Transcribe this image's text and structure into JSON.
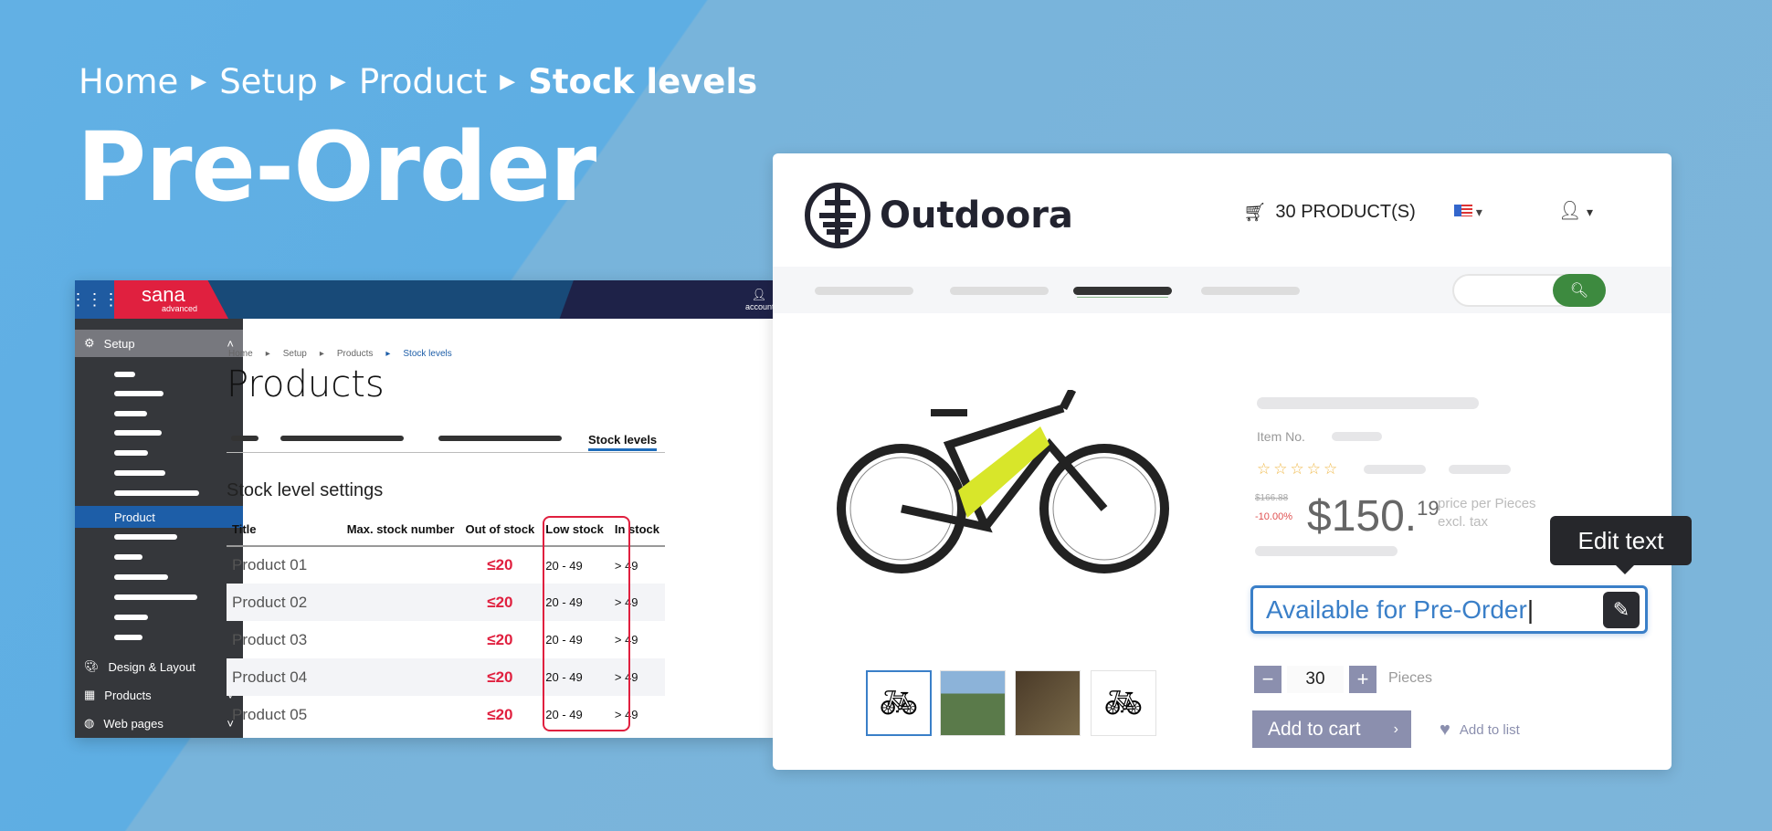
{
  "hero": {
    "breadcrumb": [
      "Home",
      "Setup",
      "Product",
      "Stock levels"
    ],
    "title": "Pre-Order"
  },
  "admin": {
    "brand": "sana",
    "brand_sub": "advanced",
    "account": "account",
    "sidebar": {
      "setup": "Setup",
      "active_item": "Product",
      "design": "Design & Layout",
      "products": "Products",
      "web_pages": "Web pages"
    },
    "breadcrumb": [
      "Home",
      "Setup",
      "Products",
      "Stock levels"
    ],
    "page_title": "Products",
    "active_tab": "Stock levels",
    "section_title": "Stock level settings",
    "table": {
      "headers": [
        "Title",
        "Max. stock number",
        "Out of stock",
        "Low stock",
        "In stock"
      ],
      "rows": [
        [
          "Product 01",
          "",
          "≤20",
          "20 - 49",
          "> 49"
        ],
        [
          "Product 02",
          "",
          "≤20",
          "20 - 49",
          "> 49"
        ],
        [
          "Product 03",
          "",
          "≤20",
          "20 - 49",
          "> 49"
        ],
        [
          "Product 04",
          "",
          "≤20",
          "20 - 49",
          "> 49"
        ],
        [
          "Product 05",
          "",
          "≤20",
          "20 - 49",
          "> 49"
        ]
      ]
    },
    "highlight_color": "#e0203f"
  },
  "store": {
    "brand": "Outdoora",
    "cart": "30 PRODUCT(S)",
    "item_no_label": "Item No.",
    "old_price": "$166.88",
    "discount": "-10.00%",
    "price_main": "$150.",
    "price_cents": "19",
    "price_note": [
      "price per Pieces",
      "excl. tax"
    ],
    "tooltip": "Edit text",
    "edit_field_value": "Available for Pre-Order",
    "quantity": "30",
    "unit": "Pieces",
    "add_to_cart": "Add to cart",
    "add_to_list": "Add to list",
    "accent_color": "#3a7fc8",
    "search_color": "#3d8a3f"
  }
}
